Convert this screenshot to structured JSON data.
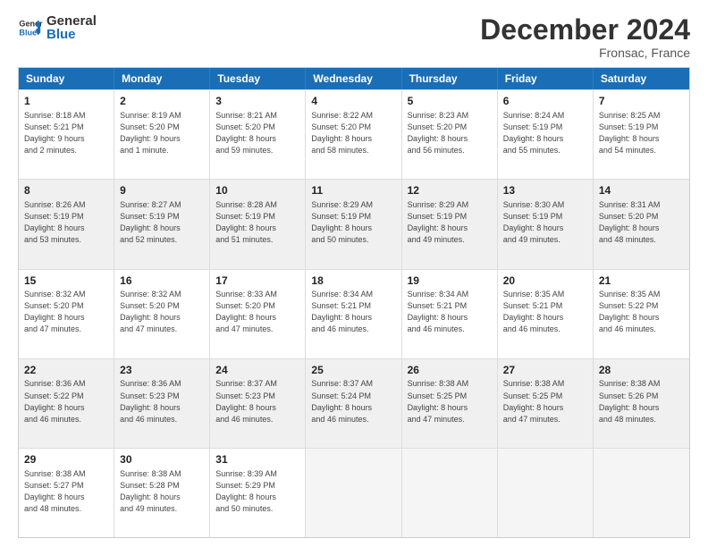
{
  "logo": {
    "line1": "General",
    "line2": "Blue"
  },
  "title": "December 2024",
  "subtitle": "Fronsac, France",
  "days": [
    "Sunday",
    "Monday",
    "Tuesday",
    "Wednesday",
    "Thursday",
    "Friday",
    "Saturday"
  ],
  "rows": [
    [
      {
        "day": "1",
        "info": "Sunrise: 8:18 AM\nSunset: 5:21 PM\nDaylight: 9 hours\nand 2 minutes.",
        "shaded": false
      },
      {
        "day": "2",
        "info": "Sunrise: 8:19 AM\nSunset: 5:20 PM\nDaylight: 9 hours\nand 1 minute.",
        "shaded": false
      },
      {
        "day": "3",
        "info": "Sunrise: 8:21 AM\nSunset: 5:20 PM\nDaylight: 8 hours\nand 59 minutes.",
        "shaded": false
      },
      {
        "day": "4",
        "info": "Sunrise: 8:22 AM\nSunset: 5:20 PM\nDaylight: 8 hours\nand 58 minutes.",
        "shaded": false
      },
      {
        "day": "5",
        "info": "Sunrise: 8:23 AM\nSunset: 5:20 PM\nDaylight: 8 hours\nand 56 minutes.",
        "shaded": false
      },
      {
        "day": "6",
        "info": "Sunrise: 8:24 AM\nSunset: 5:19 PM\nDaylight: 8 hours\nand 55 minutes.",
        "shaded": false
      },
      {
        "day": "7",
        "info": "Sunrise: 8:25 AM\nSunset: 5:19 PM\nDaylight: 8 hours\nand 54 minutes.",
        "shaded": false
      }
    ],
    [
      {
        "day": "8",
        "info": "Sunrise: 8:26 AM\nSunset: 5:19 PM\nDaylight: 8 hours\nand 53 minutes.",
        "shaded": true
      },
      {
        "day": "9",
        "info": "Sunrise: 8:27 AM\nSunset: 5:19 PM\nDaylight: 8 hours\nand 52 minutes.",
        "shaded": true
      },
      {
        "day": "10",
        "info": "Sunrise: 8:28 AM\nSunset: 5:19 PM\nDaylight: 8 hours\nand 51 minutes.",
        "shaded": true
      },
      {
        "day": "11",
        "info": "Sunrise: 8:29 AM\nSunset: 5:19 PM\nDaylight: 8 hours\nand 50 minutes.",
        "shaded": true
      },
      {
        "day": "12",
        "info": "Sunrise: 8:29 AM\nSunset: 5:19 PM\nDaylight: 8 hours\nand 49 minutes.",
        "shaded": true
      },
      {
        "day": "13",
        "info": "Sunrise: 8:30 AM\nSunset: 5:19 PM\nDaylight: 8 hours\nand 49 minutes.",
        "shaded": true
      },
      {
        "day": "14",
        "info": "Sunrise: 8:31 AM\nSunset: 5:20 PM\nDaylight: 8 hours\nand 48 minutes.",
        "shaded": true
      }
    ],
    [
      {
        "day": "15",
        "info": "Sunrise: 8:32 AM\nSunset: 5:20 PM\nDaylight: 8 hours\nand 47 minutes.",
        "shaded": false
      },
      {
        "day": "16",
        "info": "Sunrise: 8:32 AM\nSunset: 5:20 PM\nDaylight: 8 hours\nand 47 minutes.",
        "shaded": false
      },
      {
        "day": "17",
        "info": "Sunrise: 8:33 AM\nSunset: 5:20 PM\nDaylight: 8 hours\nand 47 minutes.",
        "shaded": false
      },
      {
        "day": "18",
        "info": "Sunrise: 8:34 AM\nSunset: 5:21 PM\nDaylight: 8 hours\nand 46 minutes.",
        "shaded": false
      },
      {
        "day": "19",
        "info": "Sunrise: 8:34 AM\nSunset: 5:21 PM\nDaylight: 8 hours\nand 46 minutes.",
        "shaded": false
      },
      {
        "day": "20",
        "info": "Sunrise: 8:35 AM\nSunset: 5:21 PM\nDaylight: 8 hours\nand 46 minutes.",
        "shaded": false
      },
      {
        "day": "21",
        "info": "Sunrise: 8:35 AM\nSunset: 5:22 PM\nDaylight: 8 hours\nand 46 minutes.",
        "shaded": false
      }
    ],
    [
      {
        "day": "22",
        "info": "Sunrise: 8:36 AM\nSunset: 5:22 PM\nDaylight: 8 hours\nand 46 minutes.",
        "shaded": true
      },
      {
        "day": "23",
        "info": "Sunrise: 8:36 AM\nSunset: 5:23 PM\nDaylight: 8 hours\nand 46 minutes.",
        "shaded": true
      },
      {
        "day": "24",
        "info": "Sunrise: 8:37 AM\nSunset: 5:23 PM\nDaylight: 8 hours\nand 46 minutes.",
        "shaded": true
      },
      {
        "day": "25",
        "info": "Sunrise: 8:37 AM\nSunset: 5:24 PM\nDaylight: 8 hours\nand 46 minutes.",
        "shaded": true
      },
      {
        "day": "26",
        "info": "Sunrise: 8:38 AM\nSunset: 5:25 PM\nDaylight: 8 hours\nand 47 minutes.",
        "shaded": true
      },
      {
        "day": "27",
        "info": "Sunrise: 8:38 AM\nSunset: 5:25 PM\nDaylight: 8 hours\nand 47 minutes.",
        "shaded": true
      },
      {
        "day": "28",
        "info": "Sunrise: 8:38 AM\nSunset: 5:26 PM\nDaylight: 8 hours\nand 48 minutes.",
        "shaded": true
      }
    ],
    [
      {
        "day": "29",
        "info": "Sunrise: 8:38 AM\nSunset: 5:27 PM\nDaylight: 8 hours\nand 48 minutes.",
        "shaded": false
      },
      {
        "day": "30",
        "info": "Sunrise: 8:38 AM\nSunset: 5:28 PM\nDaylight: 8 hours\nand 49 minutes.",
        "shaded": false
      },
      {
        "day": "31",
        "info": "Sunrise: 8:39 AM\nSunset: 5:29 PM\nDaylight: 8 hours\nand 50 minutes.",
        "shaded": false
      },
      {
        "day": "",
        "info": "",
        "shaded": true,
        "empty": true
      },
      {
        "day": "",
        "info": "",
        "shaded": true,
        "empty": true
      },
      {
        "day": "",
        "info": "",
        "shaded": true,
        "empty": true
      },
      {
        "day": "",
        "info": "",
        "shaded": true,
        "empty": true
      }
    ]
  ]
}
